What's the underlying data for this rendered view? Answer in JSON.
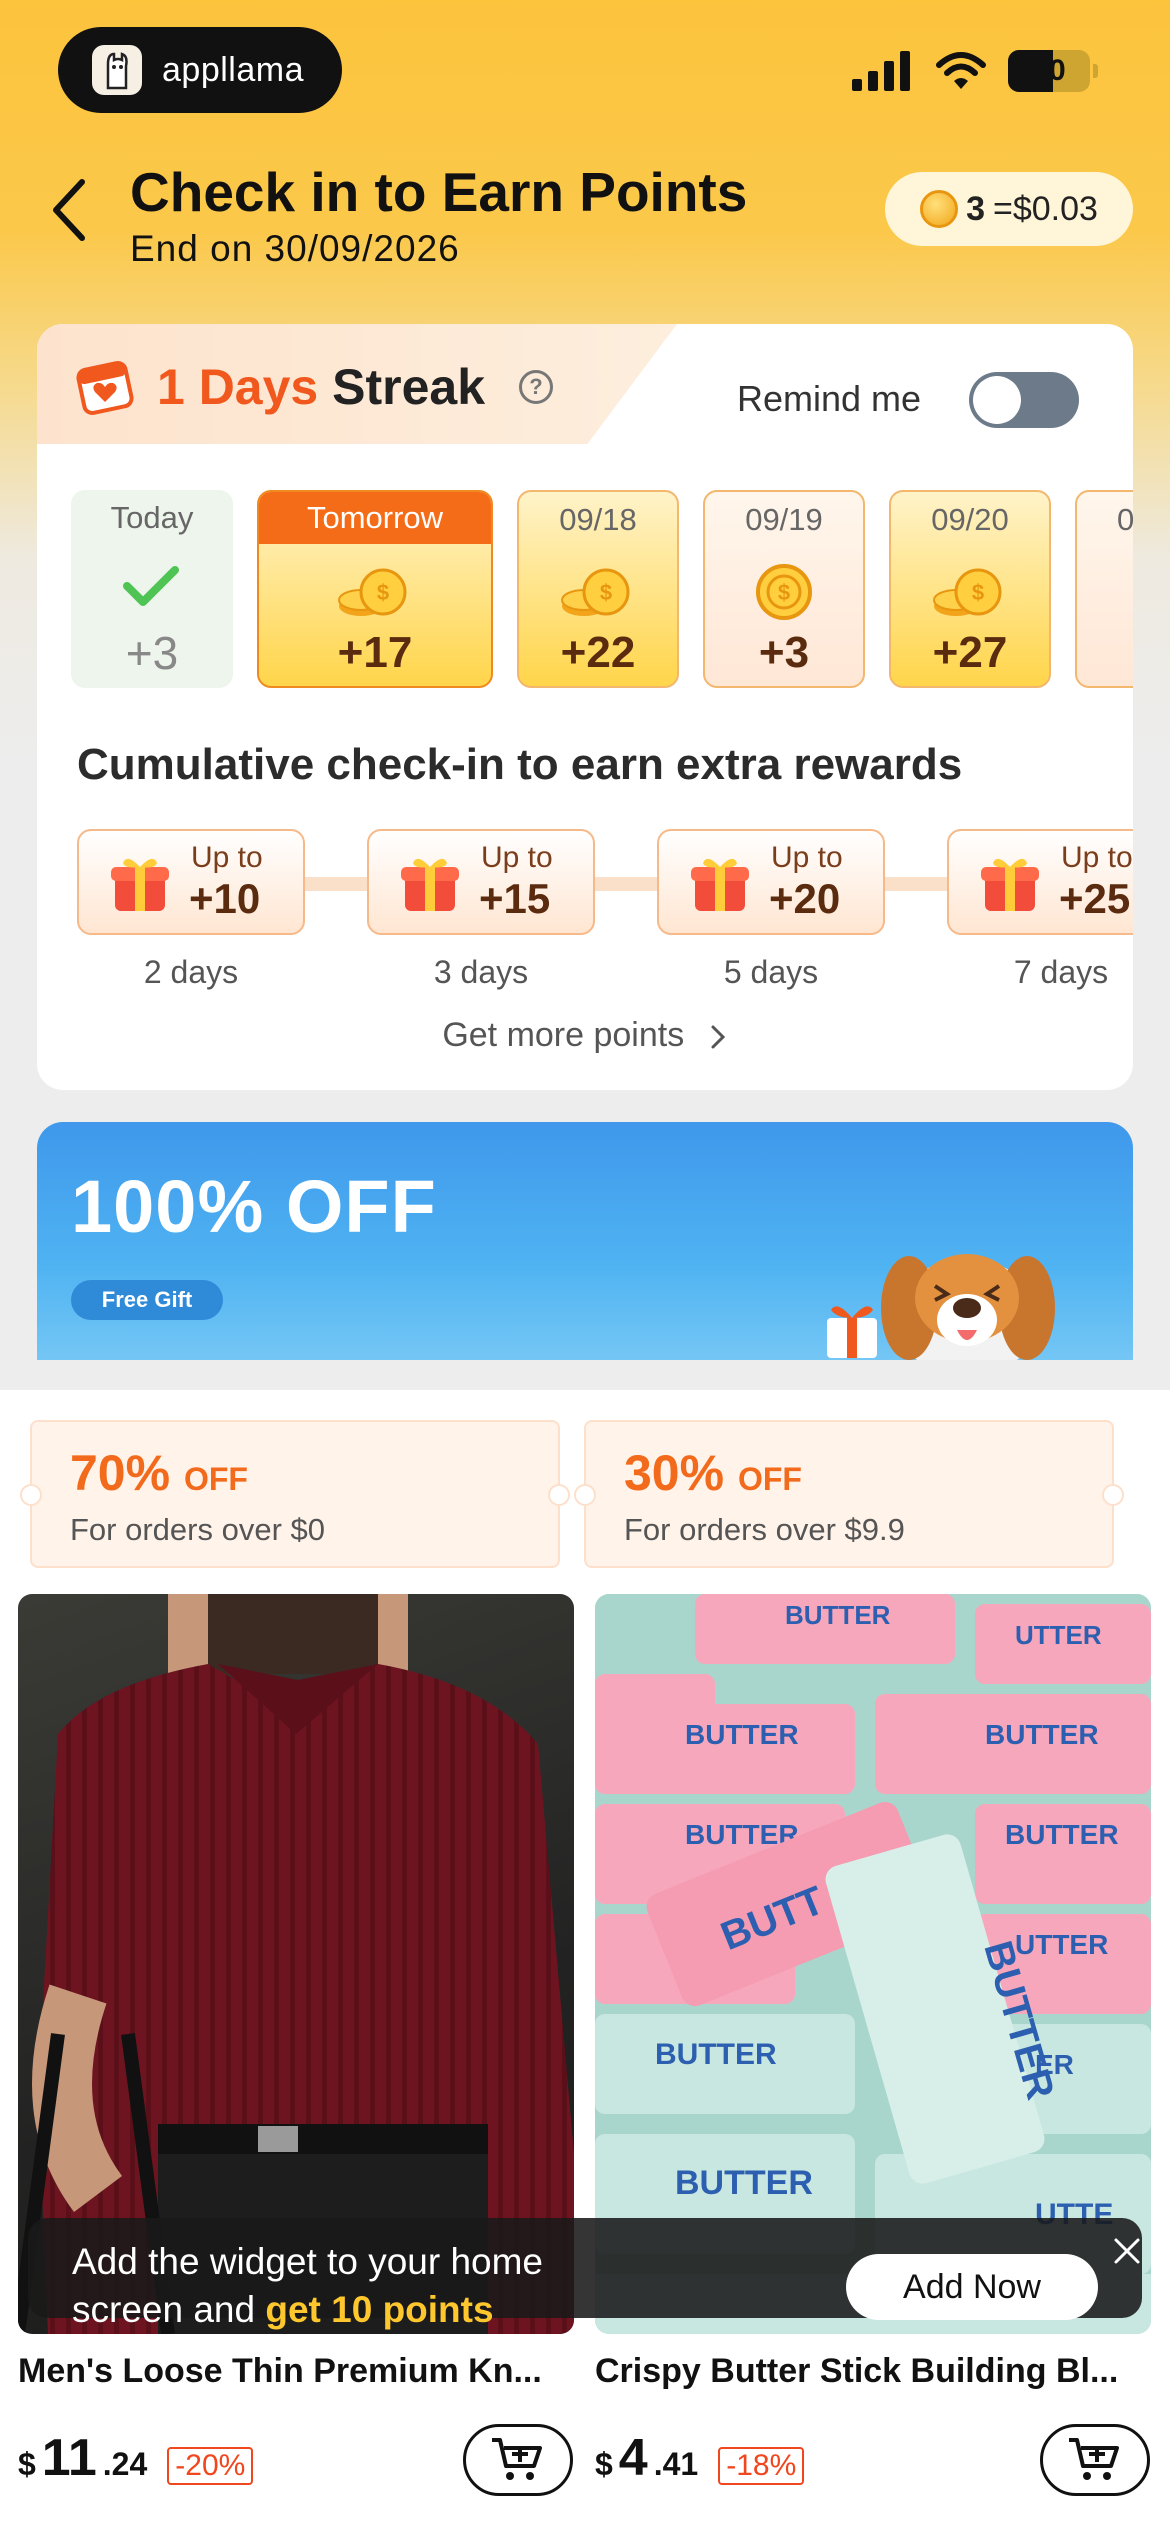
{
  "status_bar": {
    "app_name": "appllama",
    "battery": "50"
  },
  "header": {
    "title": "Check in to Earn Points",
    "subtitle": "End on 30/09/2026",
    "points_value": "3",
    "points_rate": "=$0.03"
  },
  "streak": {
    "count": "1 Days",
    "label": "Streak",
    "remind_label": "Remind me",
    "remind_on": false,
    "days": [
      {
        "label": "Today",
        "points": "+3",
        "state": "checked"
      },
      {
        "label": "Tomorrow",
        "points": "+17",
        "state": "tomorrow"
      },
      {
        "label": "09/18",
        "points": "+22",
        "state": "upcoming"
      },
      {
        "label": "09/19",
        "points": "+3",
        "state": "upcoming"
      },
      {
        "label": "09/20",
        "points": "+27",
        "state": "upcoming"
      },
      {
        "label": "0",
        "points": "",
        "state": "upcoming"
      }
    ]
  },
  "cumulative": {
    "title": "Cumulative check-in to earn extra rewards",
    "milestones": [
      {
        "up_to": "Up to",
        "amount": "+10",
        "days": "2 days"
      },
      {
        "up_to": "Up to",
        "amount": "+15",
        "days": "3 days"
      },
      {
        "up_to": "Up to",
        "amount": "+20",
        "days": "5 days"
      },
      {
        "up_to": "Up to",
        "amount": "+25",
        "days": "7 days"
      }
    ],
    "more_link": "Get more points"
  },
  "banner": {
    "title": "100% OFF",
    "badge": "Free Gift"
  },
  "coupons": [
    {
      "percent": "70%",
      "off": "OFF",
      "condition": "For orders over $0"
    },
    {
      "percent": "30%",
      "off": "OFF",
      "condition": "For orders over $9.9"
    }
  ],
  "products": [
    {
      "name": "Men's Loose Thin Premium Kn...",
      "currency": "$",
      "price_int": "11",
      "price_dec": ".24",
      "discount": "-20%"
    },
    {
      "name": "Crispy Butter Stick Building Bl...",
      "currency": "$",
      "price_int": "4",
      "price_dec": ".41",
      "discount": "-18%"
    }
  ],
  "widget_toast": {
    "line1": "Add the widget to your home",
    "line2_prefix": "screen and ",
    "line2_highlight": "get 10 points",
    "button": "Add Now"
  },
  "colors": {
    "accent": "#f56c18",
    "brand_yellow": "#fcc43d",
    "discount_red": "#f0471e"
  }
}
